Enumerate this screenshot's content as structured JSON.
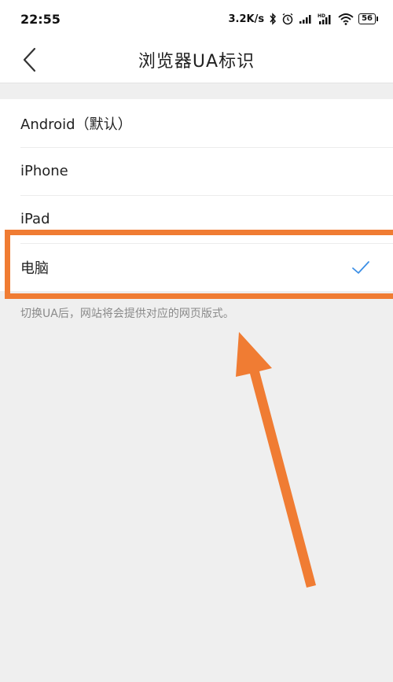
{
  "status_bar": {
    "time": "22:55",
    "net_speed": "3.2K/s",
    "battery": "56",
    "icons": [
      "bluetooth-icon",
      "alarm-icon",
      "signal-icon",
      "signal-hd-icon",
      "wifi-icon",
      "battery-icon"
    ]
  },
  "header": {
    "title": "浏览器UA标识",
    "back_icon": "chevron-left-icon"
  },
  "options": [
    {
      "label": "Android（默认）",
      "selected": false
    },
    {
      "label": "iPhone",
      "selected": false
    },
    {
      "label": "iPad",
      "selected": false
    },
    {
      "label": "电脑",
      "selected": true
    }
  ],
  "hint": "切换UA后，网站将会提供对应的网页版式。",
  "colors": {
    "accent": "#3c8fe6",
    "annotation": "#f07c33",
    "background": "#efefef"
  }
}
